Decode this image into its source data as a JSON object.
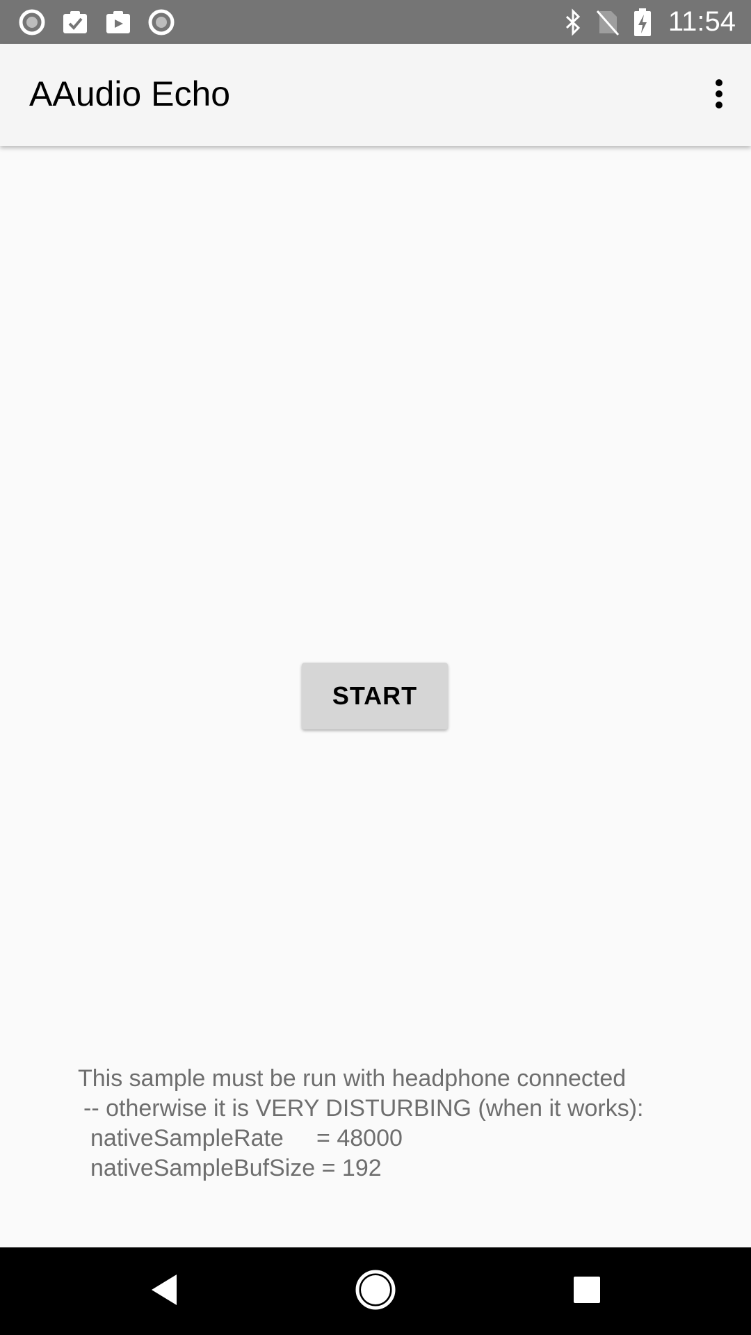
{
  "status_bar": {
    "time": "11:54",
    "left_icons": [
      "record-icon",
      "clipboard-check-icon",
      "clipboard-play-icon",
      "record-icon"
    ],
    "right_icons": [
      "bluetooth-icon",
      "no-sim-icon",
      "battery-charging-icon"
    ]
  },
  "app_bar": {
    "title": "AAudio Echo",
    "overflow_icon": "more-vert-icon"
  },
  "main": {
    "start_label": "START",
    "info_lines": [
      "This sample must be run with headphone connected",
      "-- otherwise it is VERY DISTURBING (when it works):",
      "nativeSampleRate     = 48000",
      "nativeSampleBufSize = 192"
    ]
  },
  "nav_bar": {
    "icons": [
      "back-icon",
      "home-icon",
      "recents-icon"
    ]
  },
  "colors": {
    "status_bar": "#757575",
    "app_bar": "#f5f5f5",
    "background": "#fafafa",
    "button": "#d6d6d6",
    "info_text": "#6e6e6e",
    "nav_bar": "#000000"
  }
}
